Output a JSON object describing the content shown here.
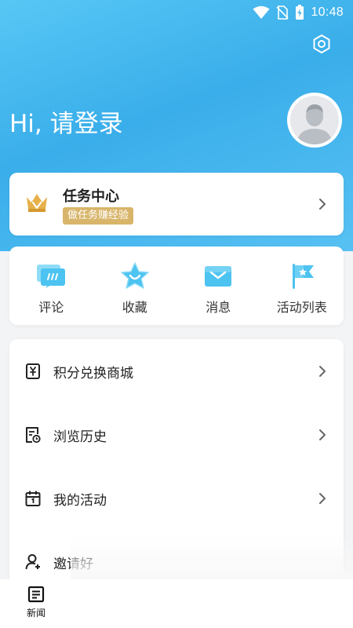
{
  "status_bar": {
    "time": "10:48"
  },
  "header": {
    "greeting": "Hi, 请登录"
  },
  "task_card": {
    "title": "任务中心",
    "badge": "做任务赚经验"
  },
  "quick_actions": [
    {
      "label": "评论",
      "icon": "comment-icon"
    },
    {
      "label": "收藏",
      "icon": "star-icon"
    },
    {
      "label": "消息",
      "icon": "envelope-icon"
    },
    {
      "label": "活动列表",
      "icon": "flag-icon"
    }
  ],
  "menu": [
    {
      "label": "积分兑换商城",
      "icon": "gift-store-icon"
    },
    {
      "label": "浏览历史",
      "icon": "history-icon"
    },
    {
      "label": "我的活动",
      "icon": "calendar-icon"
    },
    {
      "label": "邀请好",
      "icon": "add-user-icon"
    }
  ],
  "bottom_nav": {
    "news_label": "新闻"
  },
  "colors": {
    "accent": "#3aaeea",
    "badge": "#d8b56a",
    "icon_blue": "#4cc3f0"
  }
}
